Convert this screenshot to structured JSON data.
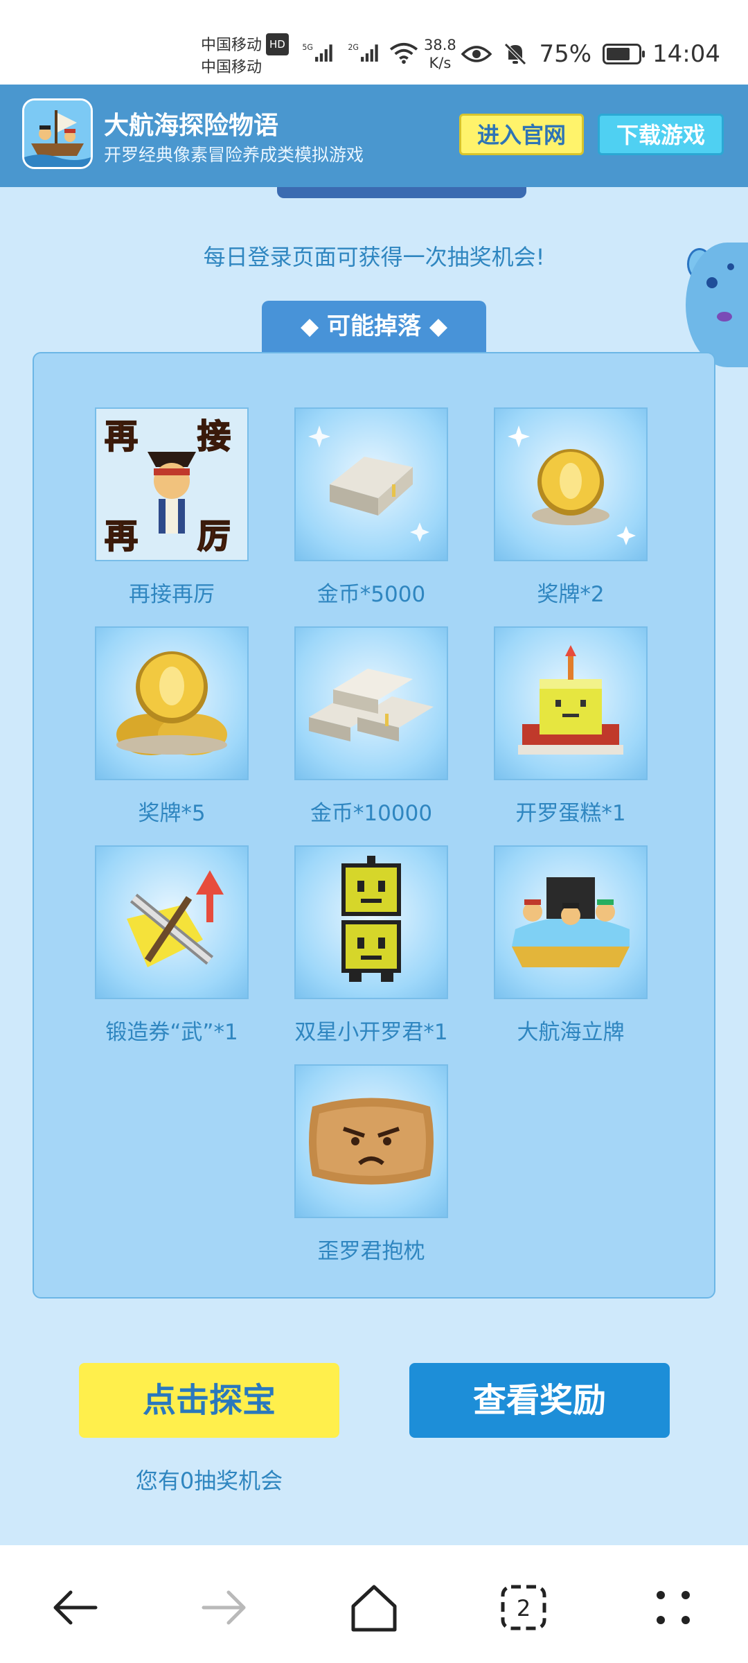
{
  "status": {
    "carrier1": "中国移动",
    "carrier1_badge": "HD",
    "carrier2": "中国移动",
    "net1": "5G",
    "net2": "2G",
    "speed_value": "38.8",
    "speed_unit": "K/s",
    "battery": "75%",
    "battery_level": 0.75,
    "time": "14:04"
  },
  "banner": {
    "title": "大航海探险物语",
    "subtitle": "开罗经典像素冒险养成类模拟游戏",
    "site_button": "进入官网",
    "download_button": "下载游戏"
  },
  "main": {
    "hint": "每日登录页面可获得一次抽奖机会!",
    "tab_label": "可能掉落",
    "items": [
      {
        "label": "再接再厉",
        "icon": "try-again-icon"
      },
      {
        "label": "金币*5000",
        "icon": "silver-bar-icon"
      },
      {
        "label": "奖牌*2",
        "icon": "gold-medal-icon"
      },
      {
        "label": "奖牌*5",
        "icon": "medal-stack-icon"
      },
      {
        "label": "金币*10000",
        "icon": "silver-bars-icon"
      },
      {
        "label": "开罗蛋糕*1",
        "icon": "cake-icon"
      },
      {
        "label": "锻造券“武”*1",
        "icon": "forge-ticket-icon"
      },
      {
        "label": "双星小开罗君*1",
        "icon": "twin-kairo-icon"
      },
      {
        "label": "大航海立牌",
        "icon": "standee-icon"
      },
      {
        "label": "歪罗君抱枕",
        "icon": "pillow-icon"
      }
    ],
    "treasure_button": "点击探宝",
    "reward_button": "查看奖励",
    "chances_text": "您有0抽奖机会"
  },
  "colors": {
    "banner_bg": "#4a97cf",
    "accent_yellow": "#ffef4c",
    "accent_blue": "#1d8ed8",
    "text_blue": "#2f86c0"
  }
}
